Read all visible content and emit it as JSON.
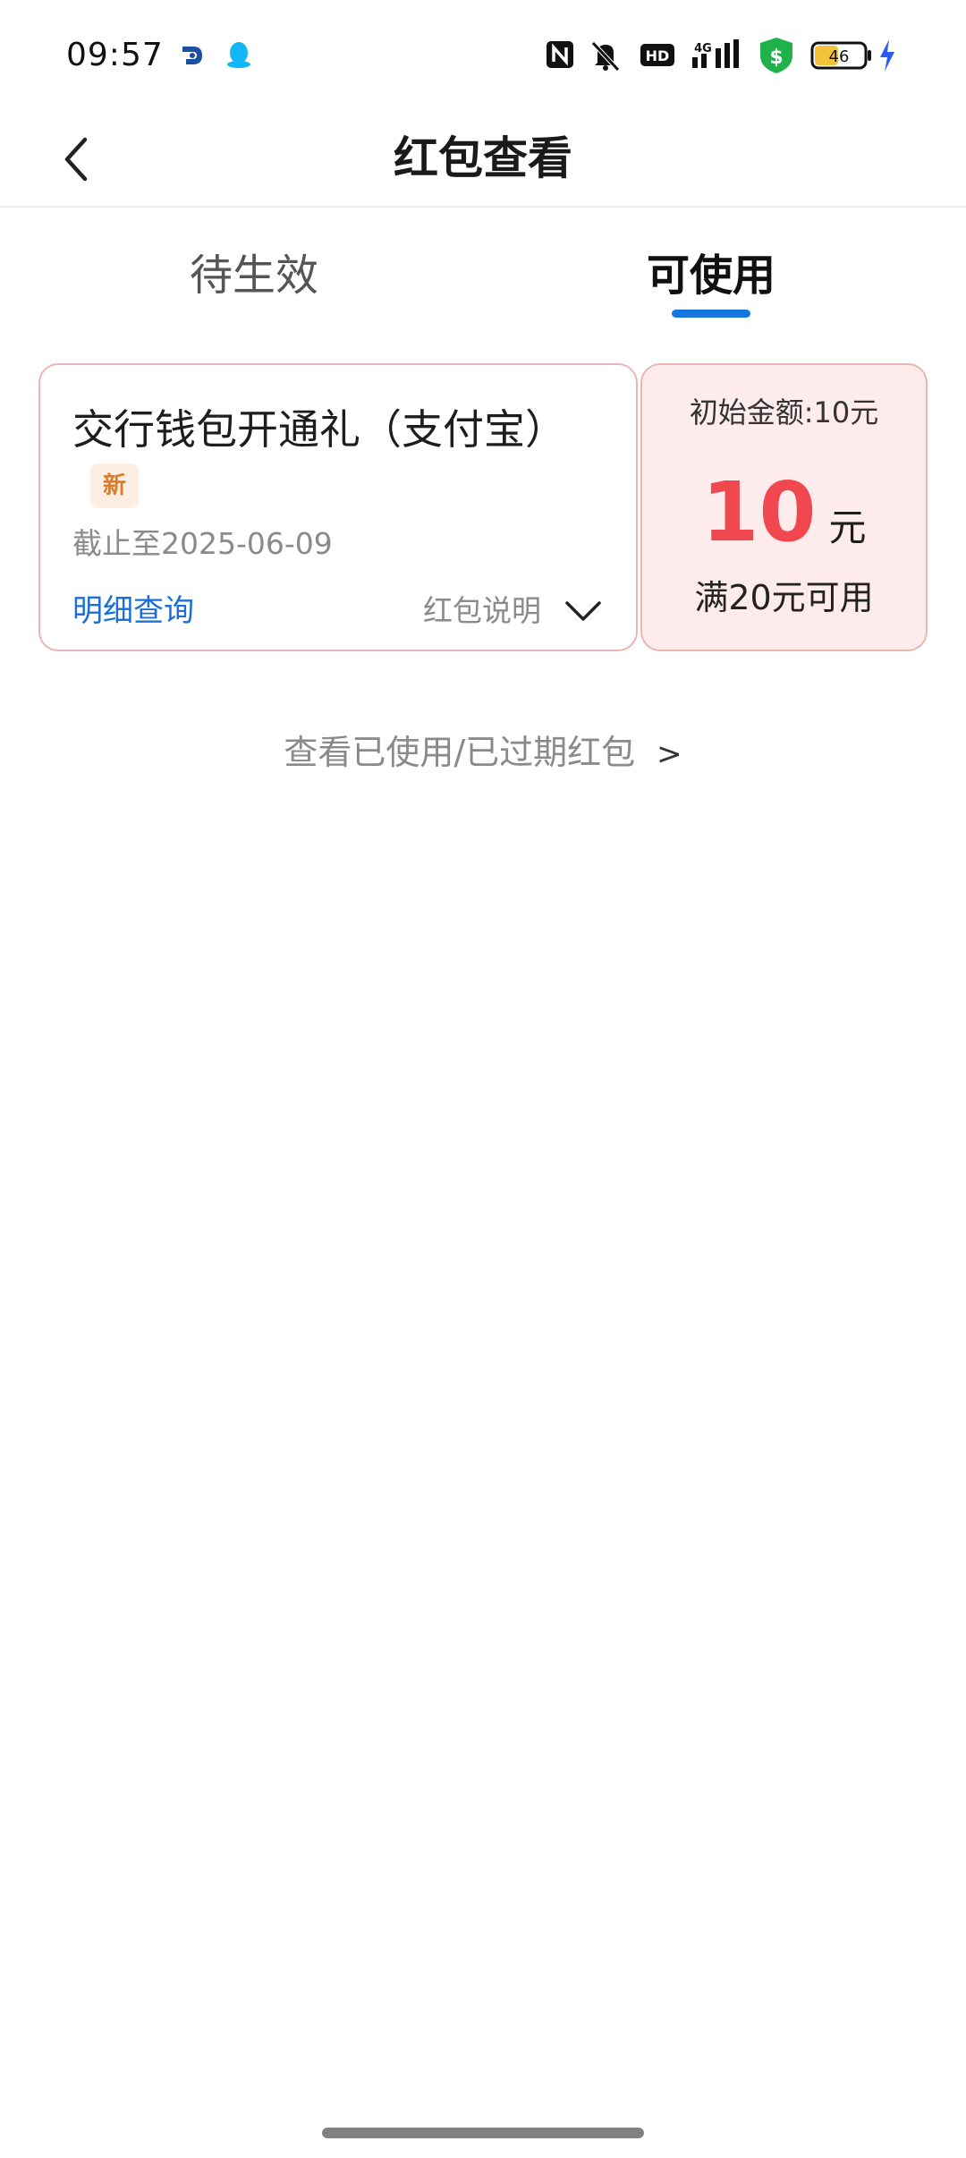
{
  "status_bar": {
    "time": "09:57",
    "battery_level": "46",
    "icons": [
      "wallet-app-icon",
      "qq-icon",
      "nfc-icon",
      "mute-icon",
      "hd-icon",
      "signal-4g-icon",
      "security-shield-icon",
      "battery-icon",
      "charging-icon"
    ]
  },
  "header": {
    "title": "红包查看"
  },
  "tabs": [
    {
      "label": "待生效",
      "active": false
    },
    {
      "label": "可使用",
      "active": true
    }
  ],
  "coupon": {
    "title": "交行钱包开通礼（支付宝）",
    "tag": "新",
    "deadline": "截止至2025-06-09",
    "detail_link": "明细查询",
    "description_label": "红包说明",
    "initial_amount": "初始金额:10元",
    "amount_value": "10",
    "amount_unit": "元",
    "condition": "满20元可用"
  },
  "history_link": {
    "label": "查看已使用/已过期红包",
    "arrow": ">"
  },
  "colors": {
    "accent_blue": "#1677e0",
    "amount_red": "#f0484e",
    "coupon_border": "#e9b7b3",
    "coupon_right_bg": "#fdeceb"
  }
}
